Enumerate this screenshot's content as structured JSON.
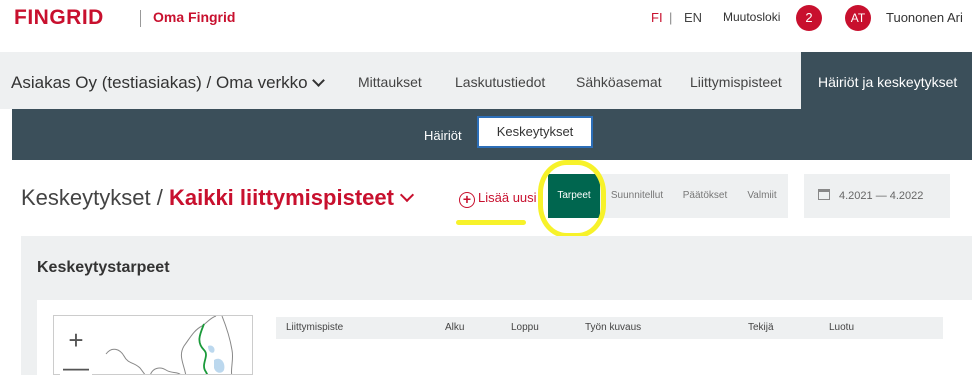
{
  "header": {
    "logo": "FINGRID",
    "subtitle": "Oma Fingrid",
    "lang_fi": "FI",
    "lang_sep": "|",
    "lang_en": "EN",
    "changelog_label": "Muutosloki",
    "changelog_count": "2",
    "avatar_initials": "AT",
    "user_name": "Tuononen Ari"
  },
  "nav": {
    "customer": "Asiakas Oy (testiasiakas) / Oma verkko",
    "items": [
      "Mittaukset",
      "Laskutustiedot",
      "Sähköasemat",
      "Liittymispisteet"
    ],
    "active": "Häiriöt ja keskeytykset"
  },
  "subnav": {
    "items": [
      "Häiriöt",
      "Keskeytykset"
    ]
  },
  "page": {
    "title_prefix": "Keskeytykset /",
    "title_accent": "Kaikki liittymispisteet",
    "add_new": "Lisää uusi",
    "tabs": [
      "Tarpeet",
      "Suunnitellut",
      "Päätökset",
      "Valmiit"
    ],
    "active_tab": "Tarpeet",
    "date_range": "4.2021 — 4.2022",
    "section_title": "Keskeytystarpeet"
  },
  "table": {
    "columns": [
      "Liittymispiste",
      "Alku",
      "Loppu",
      "Työn kuvaus",
      "Tekijä",
      "Luotu"
    ]
  },
  "map": {
    "zoom_in": "+",
    "zoom_out": "—"
  },
  "colors": {
    "brand_red": "#c8102e",
    "nav_dark": "#3b4f5a",
    "tab_active_green": "#00664f",
    "highlight_yellow": "#f7f22a"
  }
}
